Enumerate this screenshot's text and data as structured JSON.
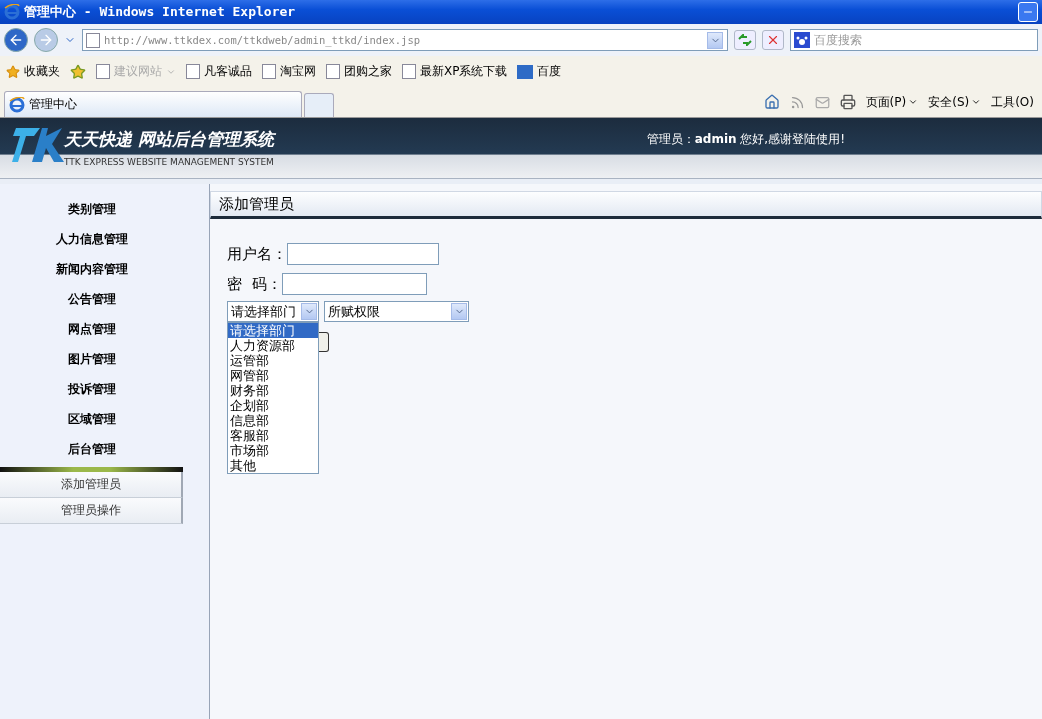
{
  "window": {
    "title": "管理中心 - Windows Internet Explorer"
  },
  "browser": {
    "address": "http://www.ttkdex.com/ttkdweb/admin_ttkd/index.jsp",
    "search_placeholder": "百度搜索",
    "favorites_label": "收藏夹",
    "favorites": [
      {
        "label": "建议网站",
        "disabled": true,
        "kind": "dropdown"
      },
      {
        "label": "凡客诚品",
        "disabled": false,
        "kind": "page"
      },
      {
        "label": "淘宝网",
        "disabled": false,
        "kind": "page"
      },
      {
        "label": "团购之家",
        "disabled": false,
        "kind": "page"
      },
      {
        "label": "最新XP系统下载",
        "disabled": false,
        "kind": "page"
      },
      {
        "label": "百度",
        "disabled": false,
        "kind": "pc"
      }
    ],
    "tab": "管理中心",
    "commands": [
      "页面(P)",
      "安全(S)",
      "工具(O)"
    ]
  },
  "site": {
    "title": "天天快递 网站后台管理系统",
    "subtitle": "TTK EXPRESS WEBSITE MANAGEMENT SYSTEM",
    "greeting": "管理员：**admin** 您好,感谢登陆使用!"
  },
  "sidebar": {
    "items": [
      "类别管理",
      "人力信息管理",
      "新闻内容管理",
      "公告管理",
      "网点管理",
      "图片管理",
      "投诉管理",
      "区域管理",
      "后台管理"
    ],
    "submenu": [
      "添加管理员",
      "管理员操作"
    ]
  },
  "panel": {
    "title": "添加管理员",
    "fields": [
      {
        "label": "用户名：",
        "kind": "text"
      },
      {
        "label": "密  码：",
        "kind": "password"
      }
    ],
    "department": {
      "value": "请选择部门",
      "expanded": true,
      "options": [
        {
          "label": "请选择部门",
          "selected": true
        },
        {
          "label": "人力资源部",
          "selected": false
        },
        {
          "label": "运管部",
          "selected": false
        },
        {
          "label": "网管部",
          "selected": false
        },
        {
          "label": "财务部",
          "selected": false
        },
        {
          "label": "企划部",
          "selected": false
        },
        {
          "label": "信息部",
          "selected": false
        },
        {
          "label": "客服部",
          "selected": false
        },
        {
          "label": "市场部",
          "selected": false
        },
        {
          "label": "其他",
          "selected": false
        }
      ]
    },
    "permission": {
      "value": "所赋权限"
    }
  }
}
